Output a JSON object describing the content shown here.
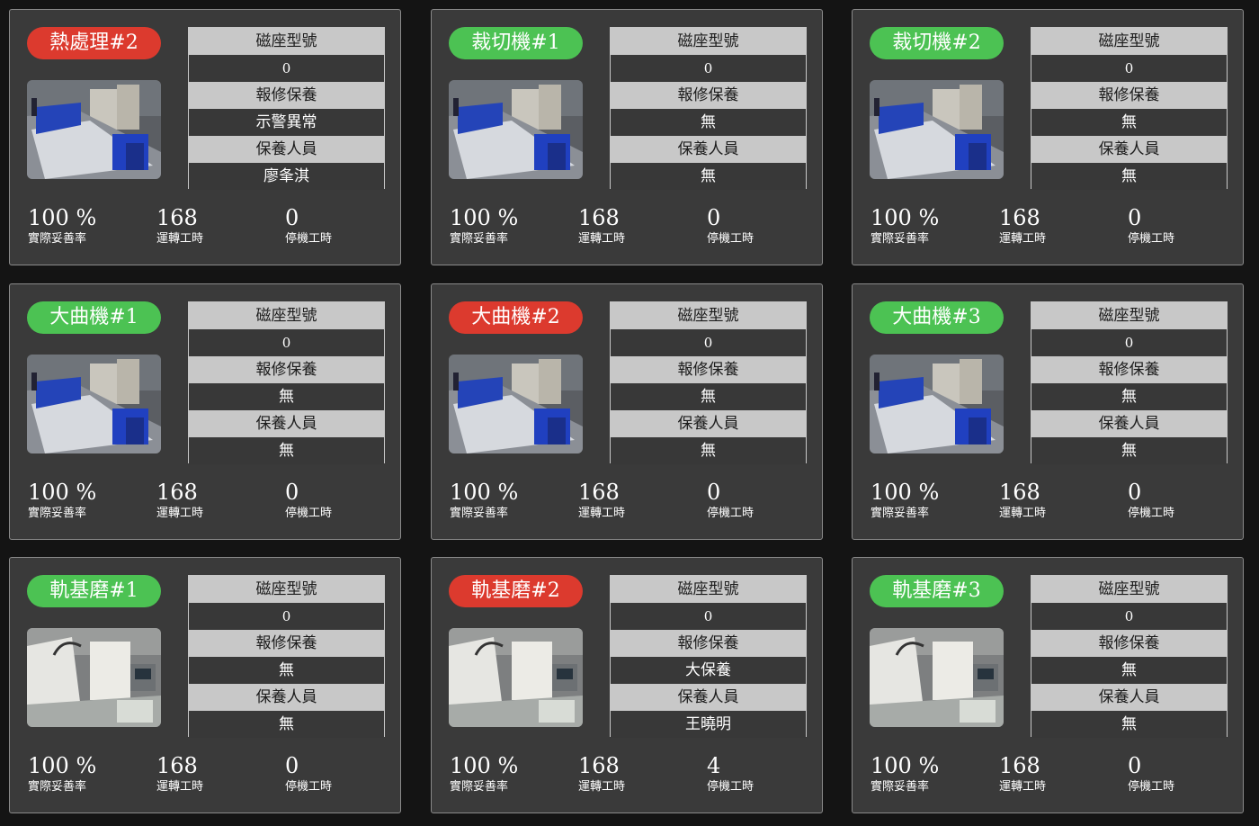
{
  "colors": {
    "background": "#141414",
    "card": "#3a3a3a",
    "status_alert": "#dc3a2e",
    "status_ok": "#4cc253",
    "label_row": "#c8c8c8",
    "value_row": "#383838"
  },
  "labels": {
    "magnet_model": "磁座型號",
    "repair_maintenance": "報修保養",
    "maintenance_staff": "保養人員",
    "availability_rate": "實際妥善率",
    "run_hours": "運轉工時",
    "down_hours": "停機工時"
  },
  "machines": [
    {
      "name": "熱處理#2",
      "status": "red",
      "photo_icon": "cutting-machine-photo",
      "magnet_model": "0",
      "repair": "示警異常",
      "staff": "廖夆淇",
      "availability": "100 %",
      "run_hours": "168",
      "down_hours": "0"
    },
    {
      "name": "裁切機#1",
      "status": "green",
      "photo_icon": "cutting-machine-photo",
      "magnet_model": "0",
      "repair": "無",
      "staff": "無",
      "availability": "100 %",
      "run_hours": "168",
      "down_hours": "0"
    },
    {
      "name": "裁切機#2",
      "status": "green",
      "photo_icon": "cutting-machine-photo",
      "magnet_model": "0",
      "repair": "無",
      "staff": "無",
      "availability": "100 %",
      "run_hours": "168",
      "down_hours": "0"
    },
    {
      "name": "大曲機#1",
      "status": "green",
      "photo_icon": "cutting-machine-photo",
      "magnet_model": "0",
      "repair": "無",
      "staff": "無",
      "availability": "100 %",
      "run_hours": "168",
      "down_hours": "0"
    },
    {
      "name": "大曲機#2",
      "status": "red",
      "photo_icon": "cutting-machine-photo",
      "magnet_model": "0",
      "repair": "無",
      "staff": "無",
      "availability": "100 %",
      "run_hours": "168",
      "down_hours": "0"
    },
    {
      "name": "大曲機#3",
      "status": "green",
      "photo_icon": "cutting-machine-photo",
      "magnet_model": "0",
      "repair": "無",
      "staff": "無",
      "availability": "100 %",
      "run_hours": "168",
      "down_hours": "0"
    },
    {
      "name": "軌基磨#1",
      "status": "green",
      "photo_icon": "grinder-machine-photo",
      "magnet_model": "0",
      "repair": "無",
      "staff": "無",
      "availability": "100 %",
      "run_hours": "168",
      "down_hours": "0"
    },
    {
      "name": "軌基磨#2",
      "status": "red",
      "photo_icon": "grinder-machine-photo",
      "magnet_model": "0",
      "repair": "大保養",
      "staff": "王曉明",
      "availability": "100 %",
      "run_hours": "168",
      "down_hours": "4"
    },
    {
      "name": "軌基磨#3",
      "status": "green",
      "photo_icon": "grinder-machine-photo",
      "magnet_model": "0",
      "repair": "無",
      "staff": "無",
      "availability": "100 %",
      "run_hours": "168",
      "down_hours": "0"
    }
  ]
}
